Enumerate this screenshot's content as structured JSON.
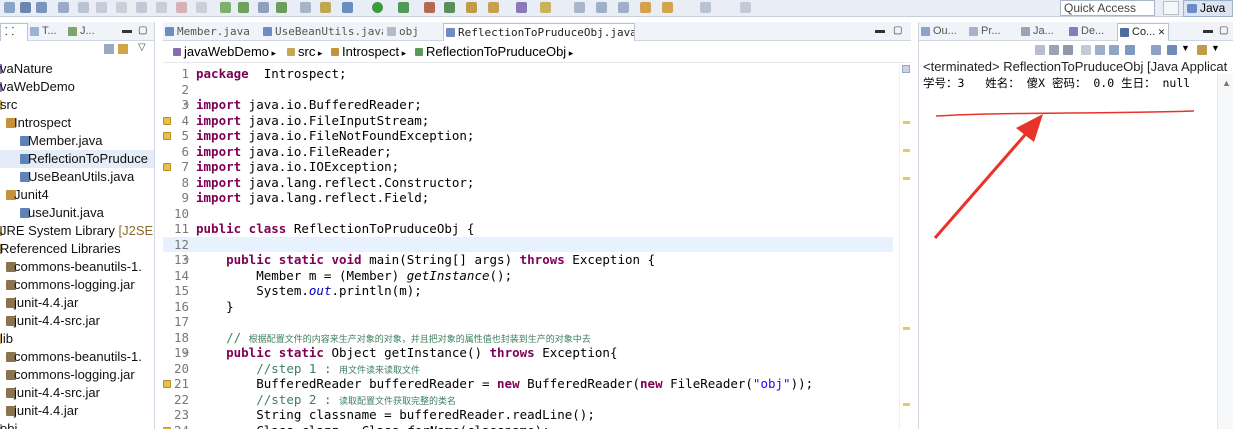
{
  "toolbar": {
    "quick_access_placeholder": "Quick Access",
    "perspective_label": "Java"
  },
  "left_panel": {
    "tabs": [
      {
        "label": "T..."
      },
      {
        "label": "J..."
      }
    ],
    "tree": [
      {
        "label": "vaNature",
        "indent": 0,
        "icon": "project-icon"
      },
      {
        "label": "vaWebDemo",
        "indent": 0,
        "icon": "project-icon"
      },
      {
        "label": "src",
        "indent": 0,
        "icon": "source-folder-icon"
      },
      {
        "label": "Introspect",
        "indent": 1,
        "icon": "package-icon"
      },
      {
        "label": "Member.java",
        "indent": 2,
        "icon": "java-file-icon"
      },
      {
        "label": "ReflectionToPruduce",
        "indent": 2,
        "icon": "java-file-icon",
        "selected": true
      },
      {
        "label": "UseBeanUtils.java",
        "indent": 2,
        "icon": "java-file-icon"
      },
      {
        "label": "Junit4",
        "indent": 1,
        "icon": "package-icon"
      },
      {
        "label": "useJunit.java",
        "indent": 2,
        "icon": "java-file-icon"
      },
      {
        "label": "JRE System Library",
        "suffix": "[J2SE-",
        "indent": 0,
        "icon": "library-icon"
      },
      {
        "label": "Referenced Libraries",
        "indent": 0,
        "icon": "library-icon"
      },
      {
        "label": "commons-beanutils-1.",
        "indent": 1,
        "icon": "jar-icon"
      },
      {
        "label": "commons-logging.jar",
        "indent": 1,
        "icon": "jar-icon"
      },
      {
        "label": "junit-4.4.jar",
        "indent": 1,
        "icon": "jar-icon"
      },
      {
        "label": "junit-4.4-src.jar",
        "indent": 1,
        "icon": "jar-icon"
      },
      {
        "label": "lib",
        "indent": 0,
        "icon": "folder-icon"
      },
      {
        "label": "commons-beanutils-1.",
        "indent": 1,
        "icon": "jar-icon"
      },
      {
        "label": "commons-logging.jar",
        "indent": 1,
        "icon": "jar-icon"
      },
      {
        "label": "junit-4.4-src.jar",
        "indent": 1,
        "icon": "jar-icon"
      },
      {
        "label": "junit-4.4.jar",
        "indent": 1,
        "icon": "jar-icon"
      },
      {
        "label": "obj",
        "indent": 0,
        "icon": "file-icon"
      }
    ]
  },
  "editor": {
    "tabs": [
      {
        "label": "Member.java",
        "active": false
      },
      {
        "label": "UseBeanUtils.java",
        "active": false
      },
      {
        "label": "obj",
        "active": false
      },
      {
        "label": "ReflectionToPruduceObj.java",
        "active": true
      }
    ],
    "breadcrumb": [
      "javaWebDemo",
      "src",
      "Introspect",
      "ReflectionToPruduceObj"
    ],
    "lines": [
      {
        "n": "1",
        "segs": [
          [
            "kw",
            "package"
          ],
          [
            "",
            "  Introspect;"
          ]
        ]
      },
      {
        "n": "2",
        "segs": []
      },
      {
        "n": "3",
        "segs": [
          [
            "kw",
            "import"
          ],
          [
            "",
            " java.io.BufferedReader;"
          ]
        ],
        "fold": true
      },
      {
        "n": "4",
        "segs": [
          [
            "kw",
            "import"
          ],
          [
            "",
            " java.io.FileInputStream;"
          ]
        ],
        "warn": true
      },
      {
        "n": "5",
        "segs": [
          [
            "kw",
            "import"
          ],
          [
            "",
            " java.io.FileNotFoundException;"
          ]
        ],
        "warn": true
      },
      {
        "n": "6",
        "segs": [
          [
            "kw",
            "import"
          ],
          [
            "",
            " java.io.FileReader;"
          ]
        ]
      },
      {
        "n": "7",
        "segs": [
          [
            "kw",
            "import"
          ],
          [
            "",
            " java.io.IOException;"
          ]
        ],
        "warn": true
      },
      {
        "n": "8",
        "segs": [
          [
            "kw",
            "import"
          ],
          [
            "",
            " java.lang.reflect.Constructor;"
          ]
        ]
      },
      {
        "n": "9",
        "segs": [
          [
            "kw",
            "import"
          ],
          [
            "",
            " java.lang.reflect.Field;"
          ]
        ]
      },
      {
        "n": "10",
        "segs": []
      },
      {
        "n": "11",
        "segs": [
          [
            "kw",
            "public class"
          ],
          [
            "",
            " ReflectionToPruduceObj {"
          ]
        ]
      },
      {
        "n": "12",
        "segs": [],
        "current": true
      },
      {
        "n": "13",
        "segs": [
          [
            "",
            "    "
          ],
          [
            "kw",
            "public static void"
          ],
          [
            "",
            " main(String[] args) "
          ],
          [
            "kw",
            "throws"
          ],
          [
            "",
            " Exception {"
          ]
        ],
        "fold": true
      },
      {
        "n": "14",
        "segs": [
          [
            "",
            "        Member m = (Member) "
          ],
          [
            "it",
            "getInstance"
          ],
          [
            "",
            "();"
          ]
        ]
      },
      {
        "n": "15",
        "segs": [
          [
            "",
            "        System."
          ],
          [
            "fld",
            "out"
          ],
          [
            "",
            ".println(m);"
          ]
        ]
      },
      {
        "n": "16",
        "segs": [
          [
            "",
            "    }"
          ]
        ]
      },
      {
        "n": "17",
        "segs": []
      },
      {
        "n": "18",
        "segs": [
          [
            "",
            "    "
          ],
          [
            "cm",
            "// "
          ],
          [
            "cmcn",
            "根据配置文件的内容来生产对象的对象，并且把对象的属性值也封装到生产的对象中去"
          ]
        ]
      },
      {
        "n": "19",
        "segs": [
          [
            "",
            "    "
          ],
          [
            "kw",
            "public static"
          ],
          [
            "",
            " Object getInstance() "
          ],
          [
            "kw",
            "throws"
          ],
          [
            "",
            " Exception{"
          ]
        ],
        "fold": true
      },
      {
        "n": "20",
        "segs": [
          [
            "",
            "        "
          ],
          [
            "cm",
            "//step 1 : "
          ],
          [
            "cmcn",
            "用文件读来读取文件"
          ]
        ]
      },
      {
        "n": "21",
        "segs": [
          [
            "",
            "        BufferedReader bufferedReader = "
          ],
          [
            "kw",
            "new"
          ],
          [
            "",
            " BufferedReader("
          ],
          [
            "kw",
            "new"
          ],
          [
            "",
            " FileReader("
          ],
          [
            "st",
            "\"obj\""
          ],
          [
            "",
            "));"
          ]
        ],
        "warn": true
      },
      {
        "n": "22",
        "segs": [
          [
            "",
            "        "
          ],
          [
            "cm",
            "//step 2 : "
          ],
          [
            "cmcn",
            "读取配置文件获取完整的类名"
          ]
        ]
      },
      {
        "n": "23",
        "segs": [
          [
            "",
            "        String classname = bufferedReader.readLine();"
          ]
        ]
      },
      {
        "n": "24",
        "segs": [
          [
            "",
            "        Class clazz = Class."
          ],
          [
            "it",
            "forName"
          ],
          [
            "",
            "(classname);"
          ]
        ],
        "warn": true
      }
    ]
  },
  "console": {
    "tabs": [
      {
        "label": "Ou..."
      },
      {
        "label": "Pr..."
      },
      {
        "label": "Ja..."
      },
      {
        "label": "De..."
      },
      {
        "label": "Co...",
        "active": true
      }
    ],
    "description": "<terminated> ReflectionToPruduceObj [Java Applicat",
    "output": "学号：3   姓名： 傻X 密码： 0.0 生日： null"
  },
  "colors": {
    "keyword": "#7f0055",
    "comment": "#3f7f5f",
    "string": "#2a00ff",
    "field": "#0000c0",
    "annotation_arrow": "#e8332a"
  }
}
